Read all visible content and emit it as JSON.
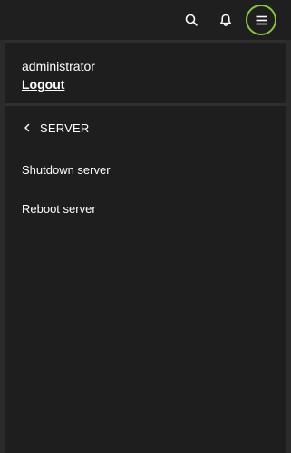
{
  "header": {
    "icons": [
      "search-icon",
      "bell-icon",
      "hamburger-menu-icon"
    ],
    "accent_color": "#8bc53f"
  },
  "user": {
    "name": "administrator",
    "logout_label": "Logout"
  },
  "submenu": {
    "back_icon": "chevron-left-icon",
    "title": "SERVER",
    "items": [
      {
        "label": "Shutdown server"
      },
      {
        "label": "Reboot server"
      }
    ]
  }
}
